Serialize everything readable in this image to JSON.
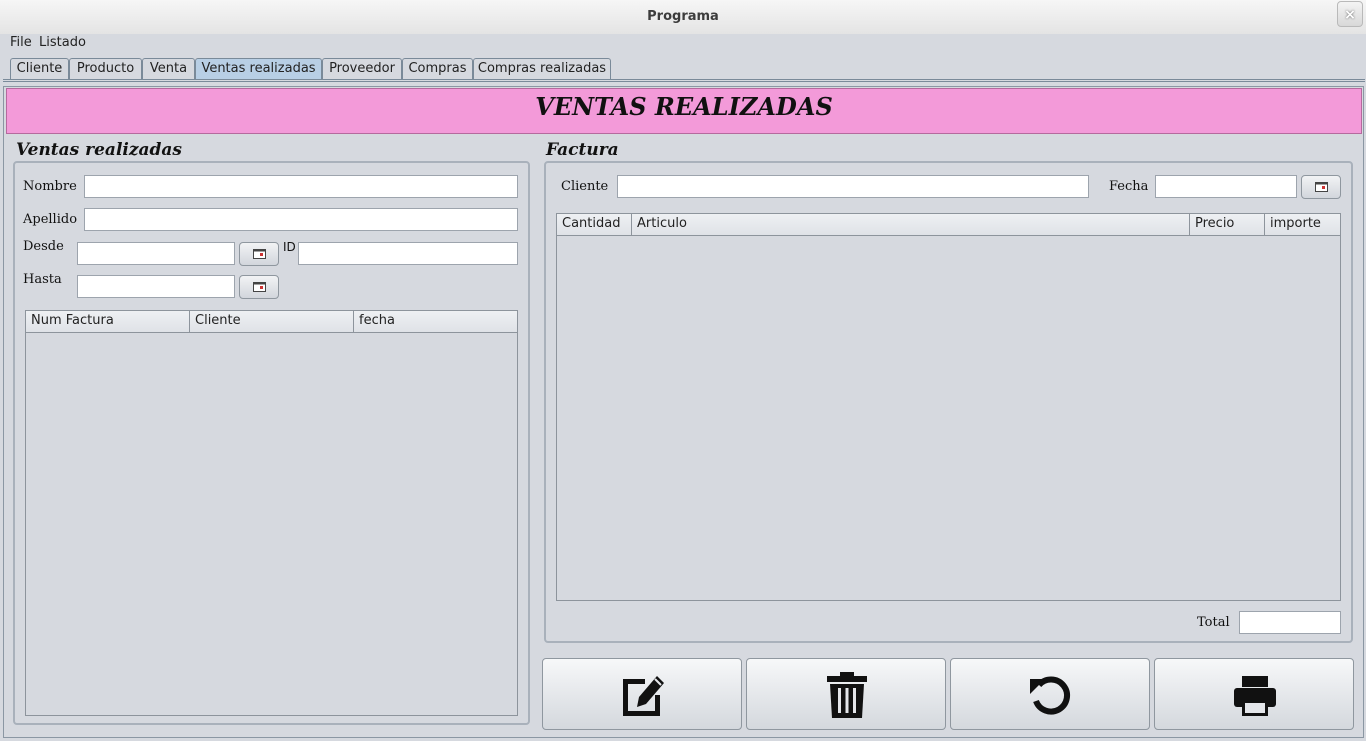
{
  "window": {
    "title": "Programa",
    "close_glyph": "×"
  },
  "menu": [
    "File",
    "Listado"
  ],
  "tabs": [
    "Cliente",
    "Producto",
    "Venta",
    "Ventas realizadas",
    "Proveedor",
    "Compras",
    "Compras realizadas"
  ],
  "active_tab": "Ventas realizadas",
  "banner": {
    "title": "VENTAS REALIZADAS",
    "color": "#f39ad9"
  },
  "left_panel": {
    "title": "Ventas realizadas",
    "nombre_label": "Nombre",
    "nombre_value": "",
    "apellido_label": "Apellido",
    "apellido_value": "",
    "desde_label": "Desde",
    "desde_value": "",
    "id_label": "ID",
    "id_value": "",
    "hasta_label": "Hasta",
    "hasta_value": "",
    "table_columns": [
      "Num Factura",
      "Cliente",
      "fecha"
    ]
  },
  "right_panel": {
    "title": "Factura",
    "cliente_label": "Cliente",
    "cliente_value": "",
    "fecha_label": "Fecha",
    "fecha_value": "",
    "table_columns": [
      "Cantidad",
      "Articulo",
      "Precio",
      "importe"
    ],
    "total_label": "Total",
    "total_value": ""
  },
  "actions": [
    {
      "name": "edit",
      "icon": "edit-icon"
    },
    {
      "name": "delete",
      "icon": "trash-icon"
    },
    {
      "name": "refresh",
      "icon": "refresh-icon"
    },
    {
      "name": "print",
      "icon": "printer-icon"
    }
  ]
}
